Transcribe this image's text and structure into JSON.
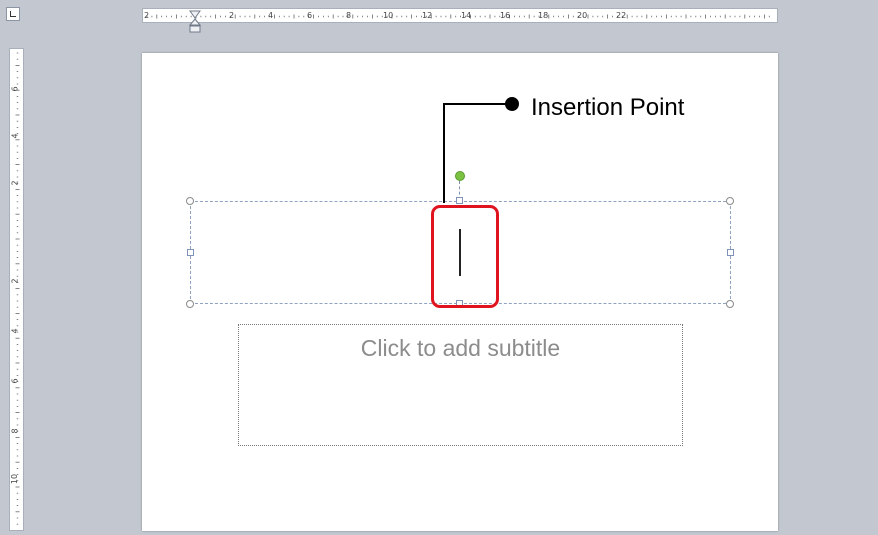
{
  "ruler": {
    "horizontal_labels": [
      "2",
      "2",
      "4",
      "6",
      "8",
      "10",
      "12",
      "14",
      "16",
      "18",
      "20",
      "22"
    ],
    "vertical_labels": [
      "6",
      "4",
      "2",
      "2",
      "4",
      "6",
      "8",
      "10"
    ]
  },
  "slide": {
    "subtitle_placeholder": "Click to add subtitle"
  },
  "callout": {
    "label": "Insertion Point"
  },
  "colors": {
    "highlight": "#e0141e",
    "rotate_handle": "#7cc241",
    "workspace": "#c3c8d0"
  }
}
